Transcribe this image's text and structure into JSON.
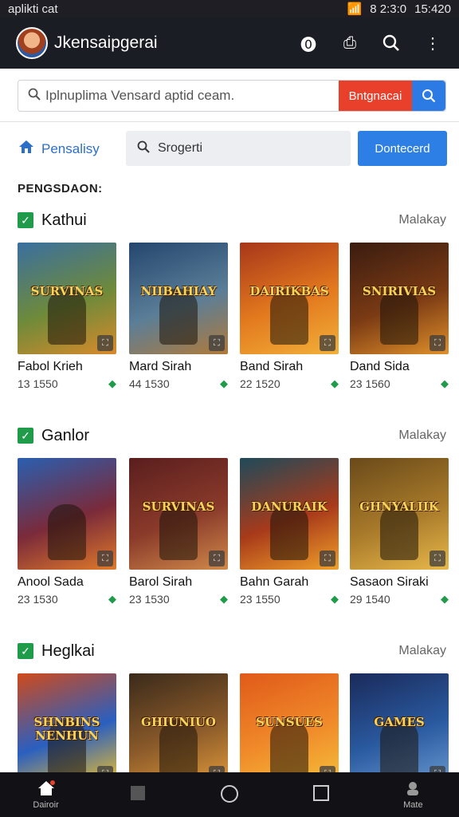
{
  "status_bar": {
    "left_text": "aplikti cat",
    "right_text": "8 2:3:0",
    "time": "15:420"
  },
  "app_bar": {
    "title": "Jkensaipgerai"
  },
  "search": {
    "value": "Iplnuplima Vensard aptid ceam.",
    "red_button": "Bntgnacai"
  },
  "filter": {
    "home_label": "Pensalisy",
    "input_value": "Srogerti",
    "primary_button": "Dontecerd"
  },
  "subheading": "PENGSDAON:",
  "sections": [
    {
      "title": "Kathui",
      "more": "Malakay",
      "items": [
        {
          "name": "Fabol Krieh",
          "meta": "13 1550",
          "cover_text": "SURVINAS",
          "colors": [
            "#3a6fa0",
            "#6e8a3a",
            "#d98a2b"
          ]
        },
        {
          "name": "Mard Sirah",
          "meta": "44 1530",
          "cover_text": "NIIBAHIAY",
          "colors": [
            "#24466e",
            "#5a7e98",
            "#b07a3a"
          ]
        },
        {
          "name": "Band Sirah",
          "meta": "22 1520",
          "cover_text": "DAIRIKBAS",
          "colors": [
            "#a8361a",
            "#e37a1e",
            "#f2b03a"
          ]
        },
        {
          "name": "Dand Sida",
          "meta": "23 1560",
          "cover_text": "SNIRIVIAS",
          "colors": [
            "#3a1c10",
            "#7a3a14",
            "#e0902a"
          ]
        }
      ]
    },
    {
      "title": "Ganlor",
      "more": "Malakay",
      "items": [
        {
          "name": "Anool Sada",
          "meta": "23 1530",
          "cover_text": "",
          "colors": [
            "#2a5fb0",
            "#7a2a3a",
            "#e07a2a"
          ]
        },
        {
          "name": "Barol Sirah",
          "meta": "23 1530",
          "cover_text": "SURVINAS",
          "colors": [
            "#5a1e1e",
            "#8a3a2a",
            "#d08a4a"
          ]
        },
        {
          "name": "Bahn Garah",
          "meta": "23 1550",
          "cover_text": "DANURAIK",
          "colors": [
            "#1e4a5a",
            "#a83a1a",
            "#f0a02a"
          ]
        },
        {
          "name": "Sasaon Siraki",
          "meta": "29 1540",
          "cover_text": "GHNYALIIK",
          "colors": [
            "#6a4a1a",
            "#a87a2a",
            "#e8b84a"
          ]
        }
      ]
    },
    {
      "title": "Heglkai",
      "more": "Malakay",
      "items": [
        {
          "name": "",
          "meta": "",
          "cover_text": "SHNBINS NENHUN",
          "colors": [
            "#d04a1a",
            "#2a5fc0",
            "#f0c02a"
          ]
        },
        {
          "name": "",
          "meta": "",
          "cover_text": "GHIUNIUO",
          "colors": [
            "#3a2a1a",
            "#8a5a2a",
            "#e09a3a"
          ]
        },
        {
          "name": "",
          "meta": "",
          "cover_text": "SUNSUES",
          "colors": [
            "#e05a1a",
            "#f08a2a",
            "#f5c03a"
          ]
        },
        {
          "name": "",
          "meta": "",
          "cover_text": "GAMES",
          "colors": [
            "#1a2a5a",
            "#2a5aa0",
            "#6a9ad0"
          ]
        }
      ]
    }
  ],
  "bottom_nav": {
    "home_label": "Dairoir",
    "profile_label": "Mate"
  },
  "accent_colors": {
    "blue": "#2d7fe6",
    "red": "#e8402a",
    "green": "#1f9b4a"
  }
}
